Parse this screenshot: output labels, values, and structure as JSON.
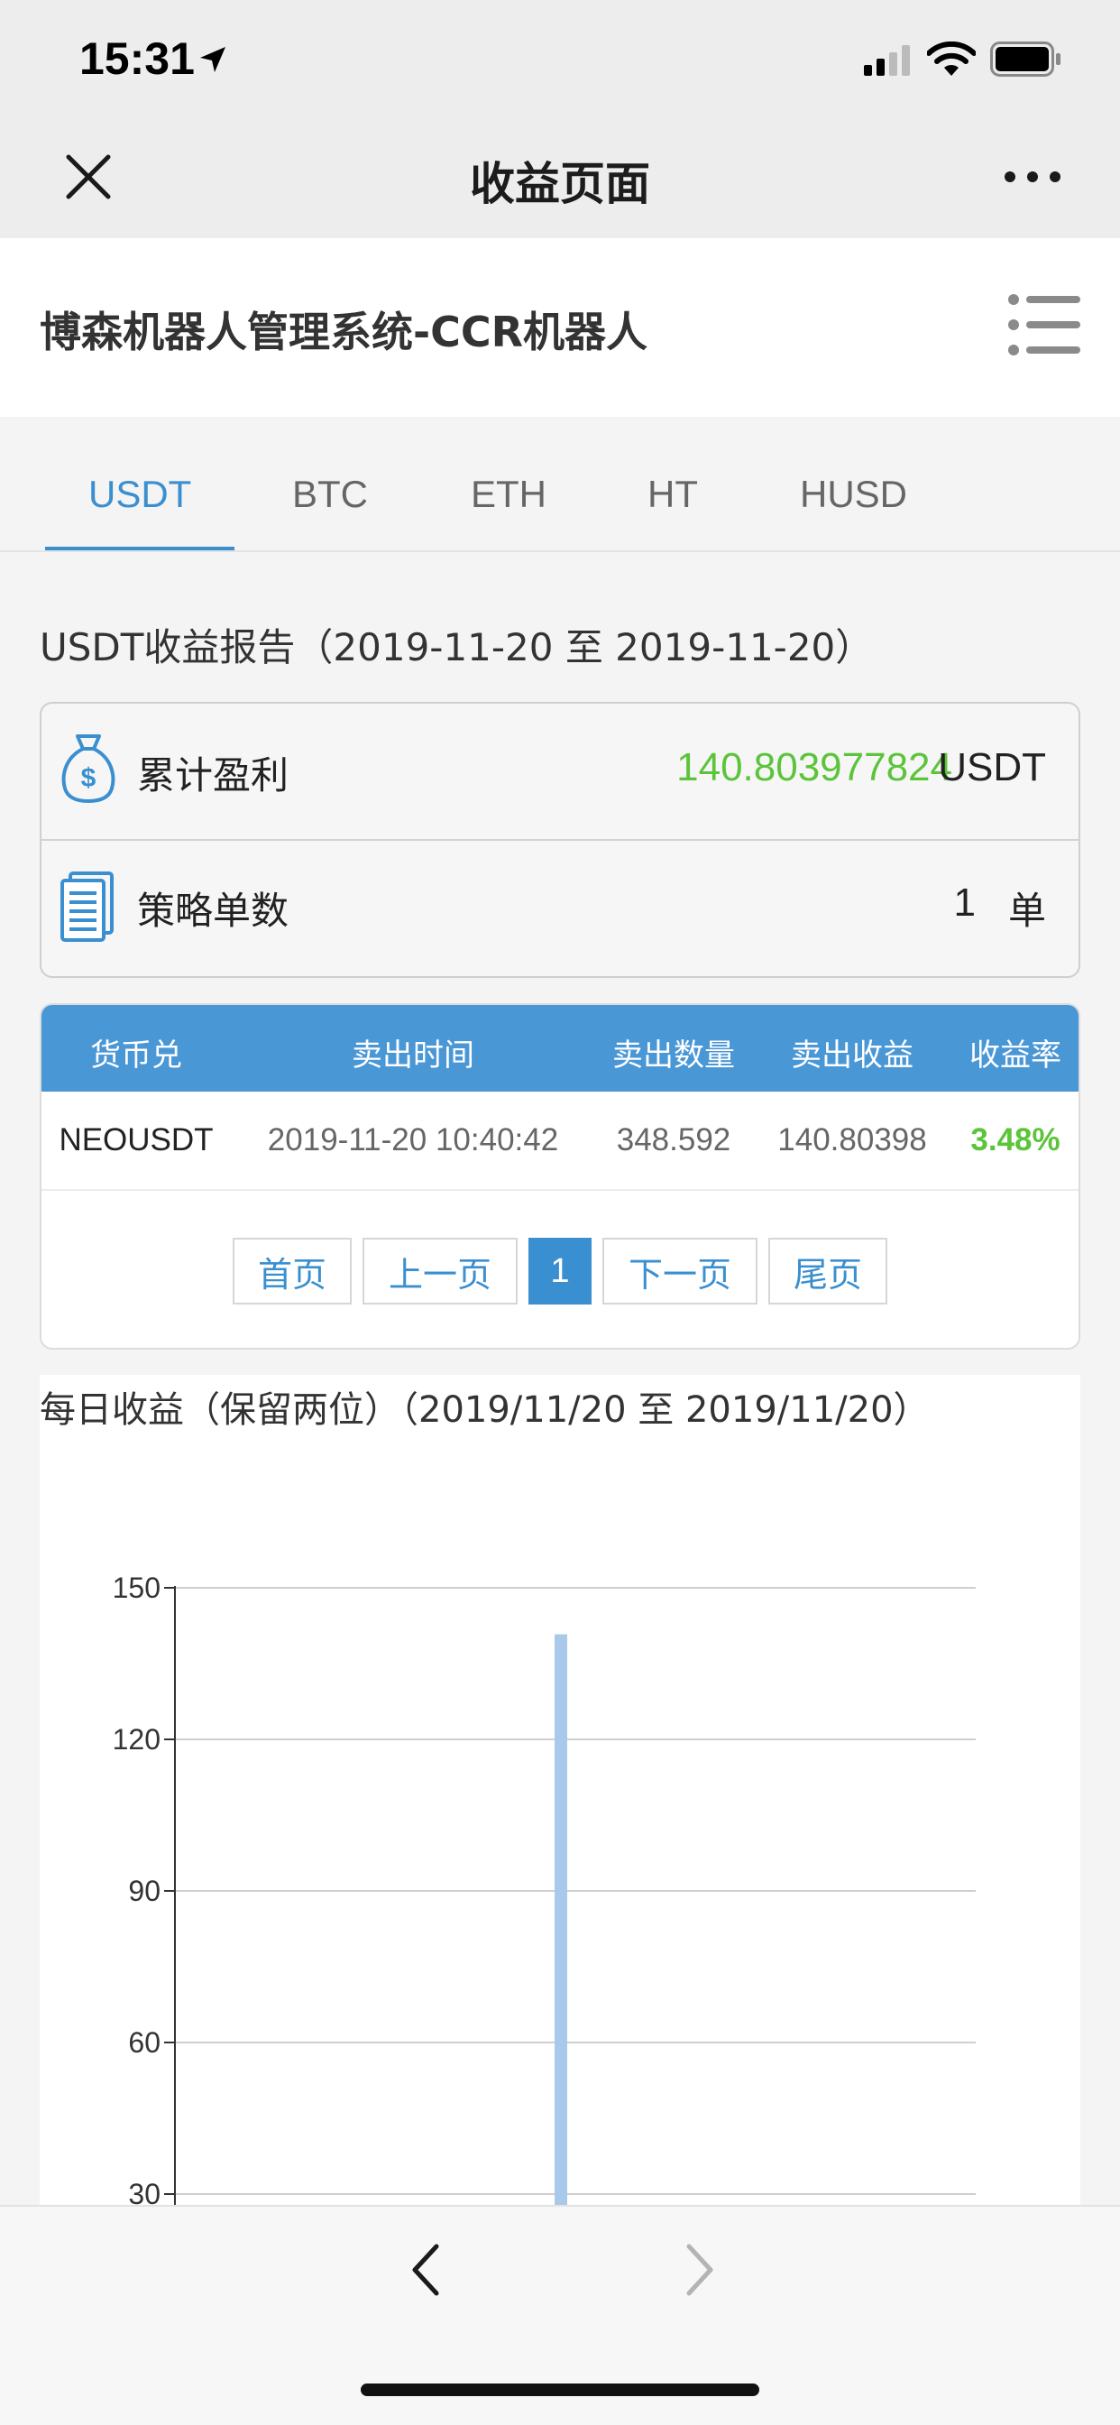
{
  "status_bar": {
    "time": "15:31"
  },
  "nav": {
    "title": "收益页面",
    "close_icon": "close-icon",
    "more_icon": "more-dots-icon"
  },
  "site": {
    "title": "博森机器人管理系统-CCR机器人",
    "menu_icon": "list-menu-icon"
  },
  "tabs": [
    {
      "label": "USDT",
      "active": true
    },
    {
      "label": "BTC",
      "active": false
    },
    {
      "label": "ETH",
      "active": false
    },
    {
      "label": "HT",
      "active": false
    },
    {
      "label": "HUSD",
      "active": false
    }
  ],
  "report": {
    "title": "USDT收益报告（2019-11-20 至 2019-11-20）",
    "profit_label": "累计盈利",
    "profit_value": "140.803977824",
    "profit_unit": "USDT",
    "count_label": "策略单数",
    "count_value": "1",
    "count_unit": "单"
  },
  "table": {
    "headers": [
      "货币兑",
      "卖出时间",
      "卖出数量",
      "卖出收益",
      "收益率"
    ],
    "rows": [
      [
        "NEOUSDT",
        "2019-11-20 10:40:42",
        "348.592",
        "140.80398",
        "3.48%"
      ]
    ]
  },
  "pagination": {
    "first": "首页",
    "prev": "上一页",
    "current": "1",
    "next": "下一页",
    "last": "尾页"
  },
  "chart_data": {
    "type": "bar",
    "title": "每日收益（保留两位）（2019/11/20 至 2019/11/20）",
    "categories": [
      ""
    ],
    "values": [
      140.8
    ],
    "yticks": [
      150,
      120,
      90,
      60,
      30
    ],
    "ylim": [
      0,
      150
    ],
    "grid": true,
    "bar_color": "#a8c9ea"
  },
  "colors": {
    "accent": "#3a8fd0",
    "profit_green": "#5cc43a",
    "table_header": "#4a97d6"
  }
}
